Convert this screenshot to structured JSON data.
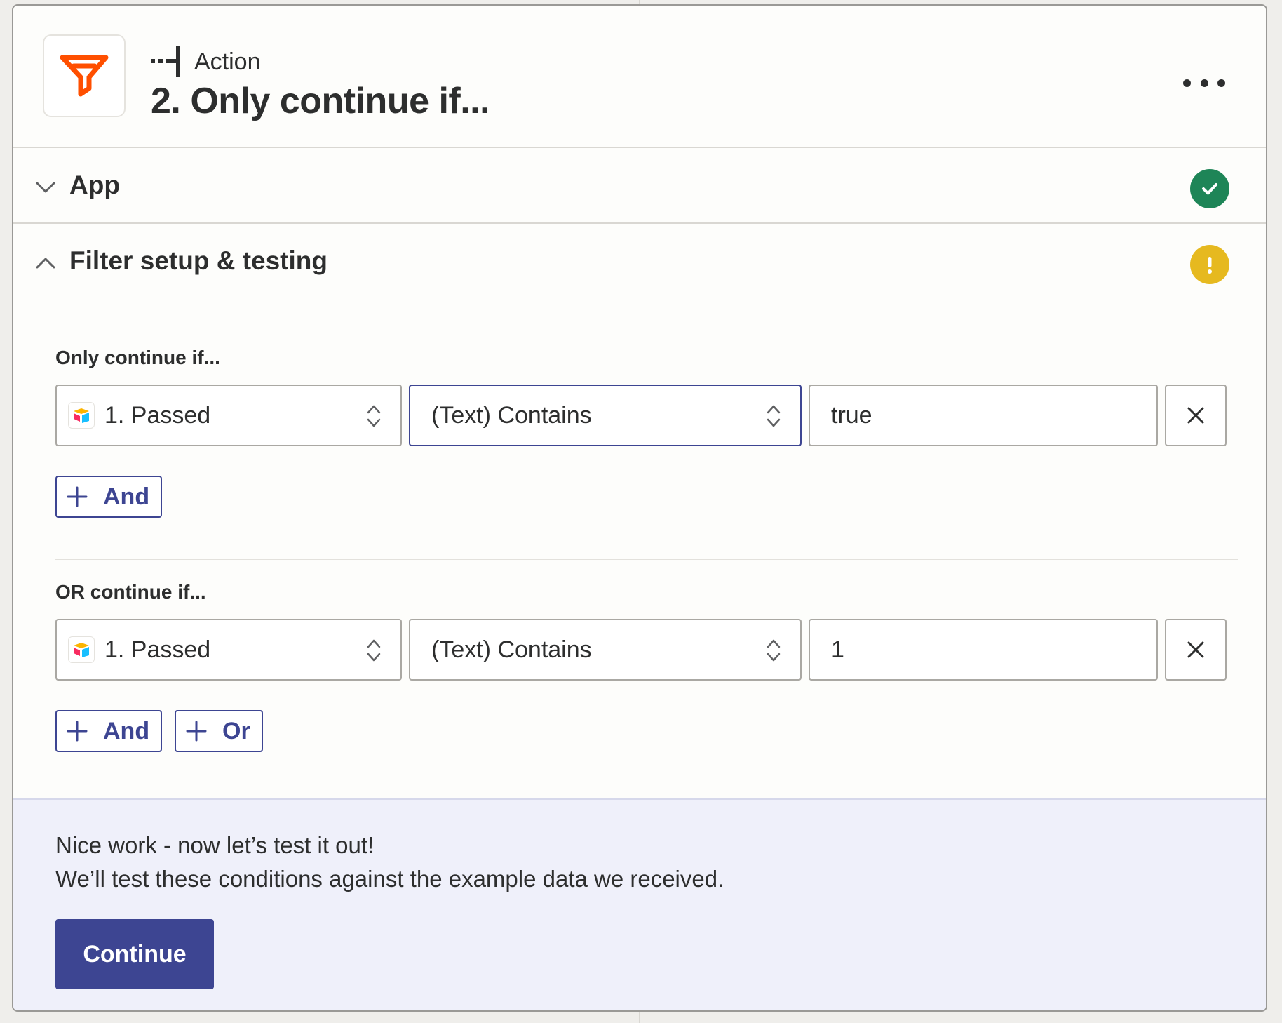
{
  "header": {
    "step_type": "Action",
    "step_title": "2. Only continue if..."
  },
  "sections": {
    "app": {
      "label": "App",
      "status": "complete"
    },
    "filter": {
      "label": "Filter setup & testing",
      "status": "warning"
    }
  },
  "groups": [
    {
      "label": "Only continue if...",
      "rules": [
        {
          "field": "1. Passed",
          "condition": "(Text) Contains",
          "value": "true"
        }
      ],
      "buttons": [
        "And"
      ]
    },
    {
      "label": "OR continue if...",
      "rules": [
        {
          "field": "1. Passed",
          "condition": "(Text) Contains",
          "value": "1"
        }
      ],
      "buttons": [
        "And",
        "Or"
      ]
    }
  ],
  "footer": {
    "heading": "Nice work - now let’s test it out!",
    "subtext": "We’ll test these conditions against the example data we received.",
    "continue_label": "Continue"
  },
  "colors": {
    "brand_orange": "#ff4f00",
    "primary": "#3d4592",
    "success": "#1e8557",
    "warning": "#e6b91f"
  }
}
